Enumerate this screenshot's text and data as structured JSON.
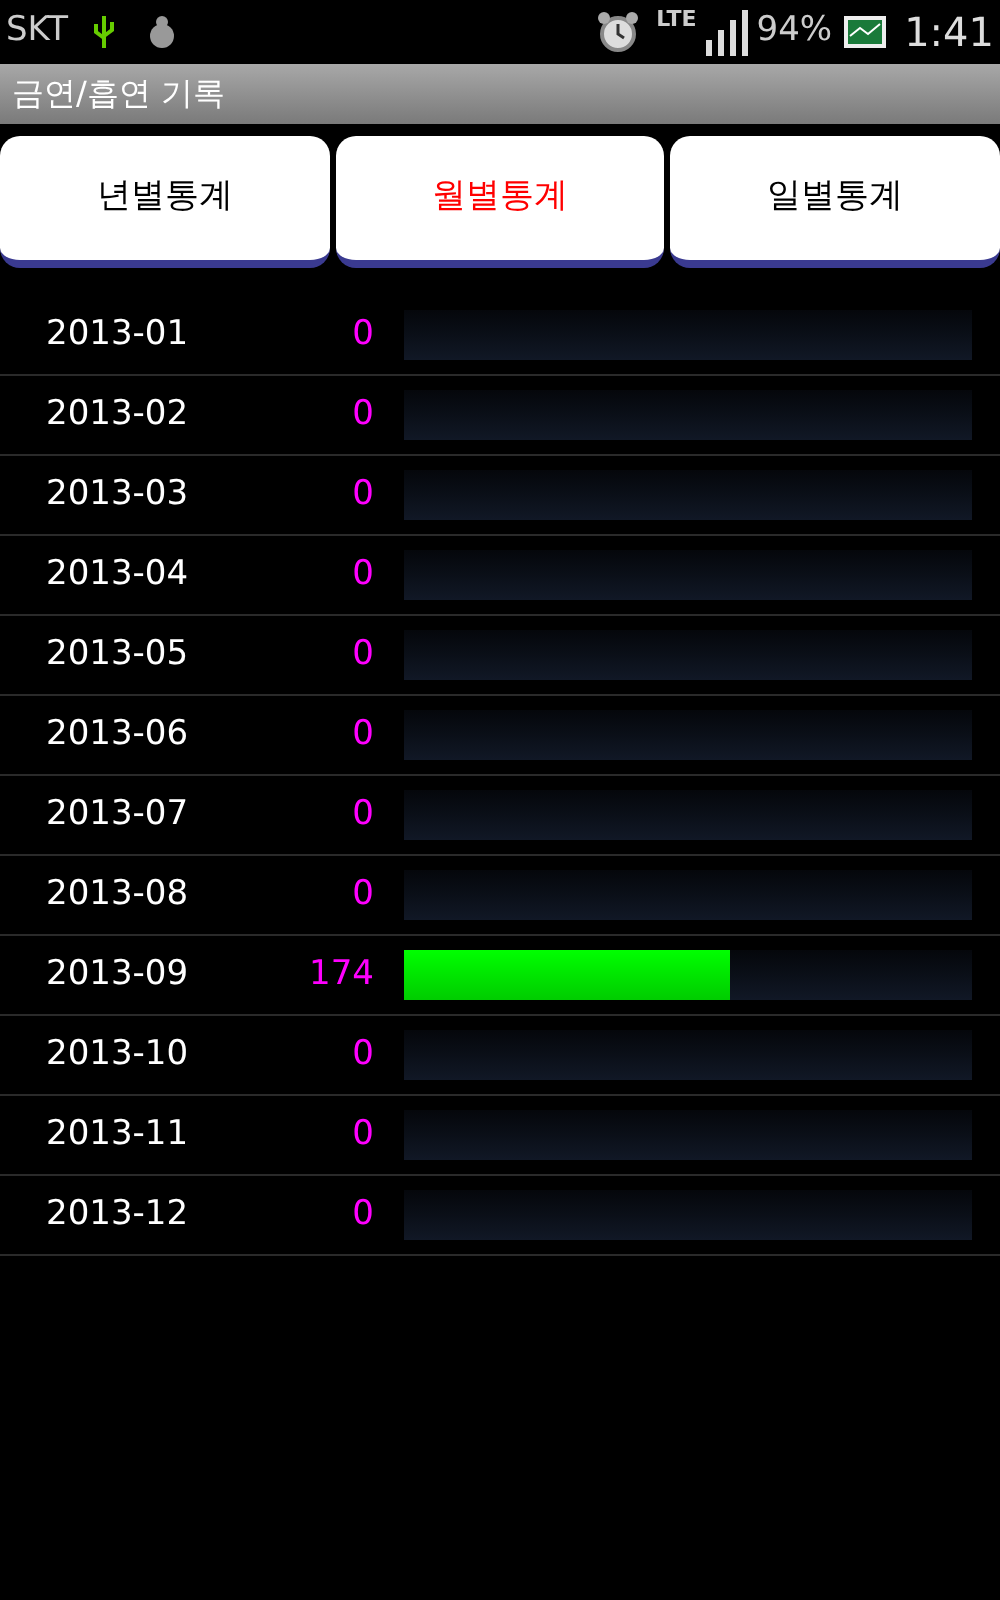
{
  "status_bar": {
    "carrier": "SKT",
    "battery": "94%",
    "time": "1:41",
    "network": "LTE"
  },
  "title": "금연/흡연 기록",
  "tabs": [
    {
      "label": "년별통계",
      "selected": false
    },
    {
      "label": "월별통계",
      "selected": true
    },
    {
      "label": "일별통계",
      "selected": false
    }
  ],
  "rows": [
    {
      "month": "2013-01",
      "count": "0"
    },
    {
      "month": "2013-02",
      "count": "0"
    },
    {
      "month": "2013-03",
      "count": "0"
    },
    {
      "month": "2013-04",
      "count": "0"
    },
    {
      "month": "2013-05",
      "count": "0"
    },
    {
      "month": "2013-06",
      "count": "0"
    },
    {
      "month": "2013-07",
      "count": "0"
    },
    {
      "month": "2013-08",
      "count": "0"
    },
    {
      "month": "2013-09",
      "count": "174",
      "level": 0.574
    },
    {
      "month": "2013-10",
      "count": "0"
    },
    {
      "month": "2013-11",
      "count": "0"
    },
    {
      "month": "2013-12",
      "count": "0"
    }
  ]
}
